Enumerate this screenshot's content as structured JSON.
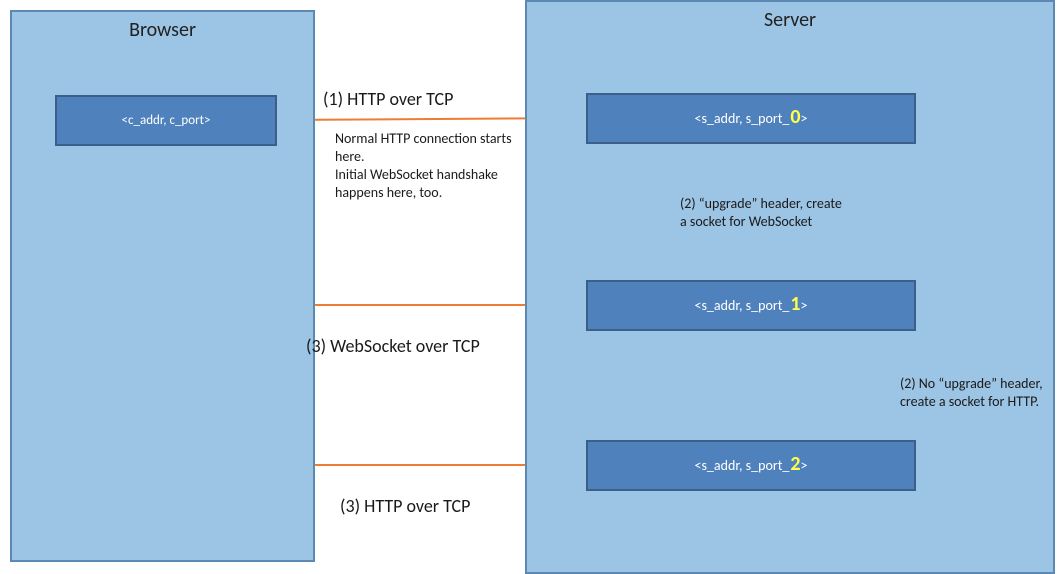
{
  "browser": {
    "title": "Browser",
    "client_node_prefix": "<c_addr, c_port>"
  },
  "server": {
    "title": "Server",
    "nodes": {
      "s0": {
        "prefix": "<s_addr, s_port_",
        "suffix": "0",
        "tail": ">"
      },
      "s1": {
        "prefix": "<s_addr, s_port_",
        "suffix": "1",
        "tail": ">"
      },
      "s2": {
        "prefix": "<s_addr, s_port_",
        "suffix": "2",
        "tail": ">"
      }
    }
  },
  "labels": {
    "step1_title": "(1) HTTP over TCP",
    "step1_note_l1": "Normal HTTP connection starts",
    "step1_note_l2": "here.",
    "step1_note_l3": "Initial WebSocket handshake",
    "step1_note_l4": "happens here, too.",
    "step2a_l1": "(2) “upgrade” header, create",
    "step2a_l2": "a socket for WebSocket",
    "step2b_l1": "(2) No “upgrade” header,",
    "step2b_l2": "create a socket for HTTP.",
    "step3_ws": "(3) WebSocket over TCP",
    "step3_http": "(3) HTTP over TCP"
  },
  "colors": {
    "panel_fill": "#9cc4e4",
    "panel_border": "#5c88b4",
    "node_fill": "#4f81bd",
    "node_border": "#3b5e8a",
    "arrow": "#ed7d31",
    "port_highlight": "#ffff4d"
  }
}
